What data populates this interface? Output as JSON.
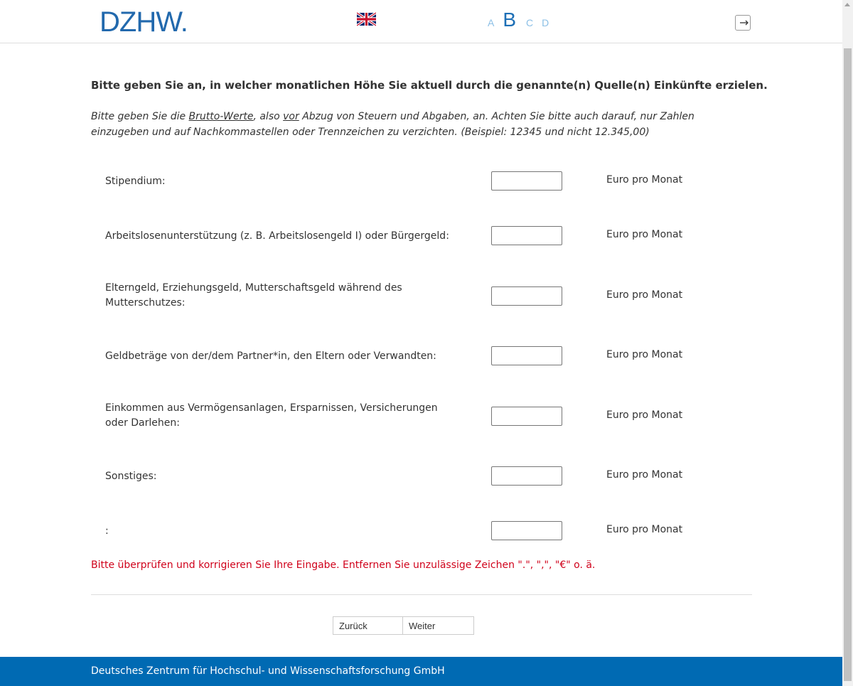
{
  "header": {
    "logo_text": "DZHW.",
    "language_flag_icon": "uk-flag-icon",
    "sections": [
      "A",
      "B",
      "C",
      "D"
    ],
    "active_section": "B",
    "logout_icon": "logout-icon"
  },
  "main": {
    "question": "Bitte geben Sie an, in welcher monatlichen Höhe Sie aktuell durch die genannte(n) Quelle(n) Einkünfte erzielen.",
    "instruction_parts": {
      "p1": "Bitte geben Sie die ",
      "u1": "Brutto-Werte",
      "p2": ", also ",
      "u2": "vor",
      "p3": " Abzug von Steuern und Abgaben, an. Achten Sie bitte auch darauf, nur Zahlen einzugeben und auf Nachkommastellen oder Trennzeichen zu verzichten. (Beispiel: 12345 und nicht 12.345,00)"
    },
    "rows": [
      {
        "label": "Stipendium:",
        "value": "",
        "unit": "Euro pro Monat"
      },
      {
        "label": "Arbeitslosenunterstützung (z. B. Arbeitslosengeld I) oder Bürgergeld:",
        "value": "",
        "unit": "Euro pro Monat"
      },
      {
        "label": "Elterngeld, Erziehungsgeld, Mutterschaftsgeld während des Mutterschutzes:",
        "value": "",
        "unit": "Euro pro Monat"
      },
      {
        "label": "Geldbeträge von der/dem Partner*in, den Eltern oder Verwandten:",
        "value": "",
        "unit": "Euro pro Monat"
      },
      {
        "label": "Einkommen aus Vermögensanlagen, Ersparnissen, Versicherungen oder Darlehen:",
        "value": "",
        "unit": "Euro pro Monat"
      },
      {
        "label": "Sonstiges:",
        "value": "",
        "unit": "Euro pro Monat"
      },
      {
        "label": ":",
        "value": "",
        "unit": "Euro pro Monat"
      }
    ],
    "error_message": "Bitte überprüfen und korrigieren Sie Ihre Eingabe. Entfernen Sie unzulässige Zeichen \".\", \",\", \"€\" o. ä.",
    "back_label": "Zurück",
    "next_label": "Weiter"
  },
  "footer": {
    "text": "Deutsches Zentrum für Hochschul- und Wissenschaftsforschung GmbH"
  },
  "colors": {
    "brand_blue": "#2269ad",
    "footer_blue": "#006ab3",
    "error_red": "#d0021b"
  }
}
